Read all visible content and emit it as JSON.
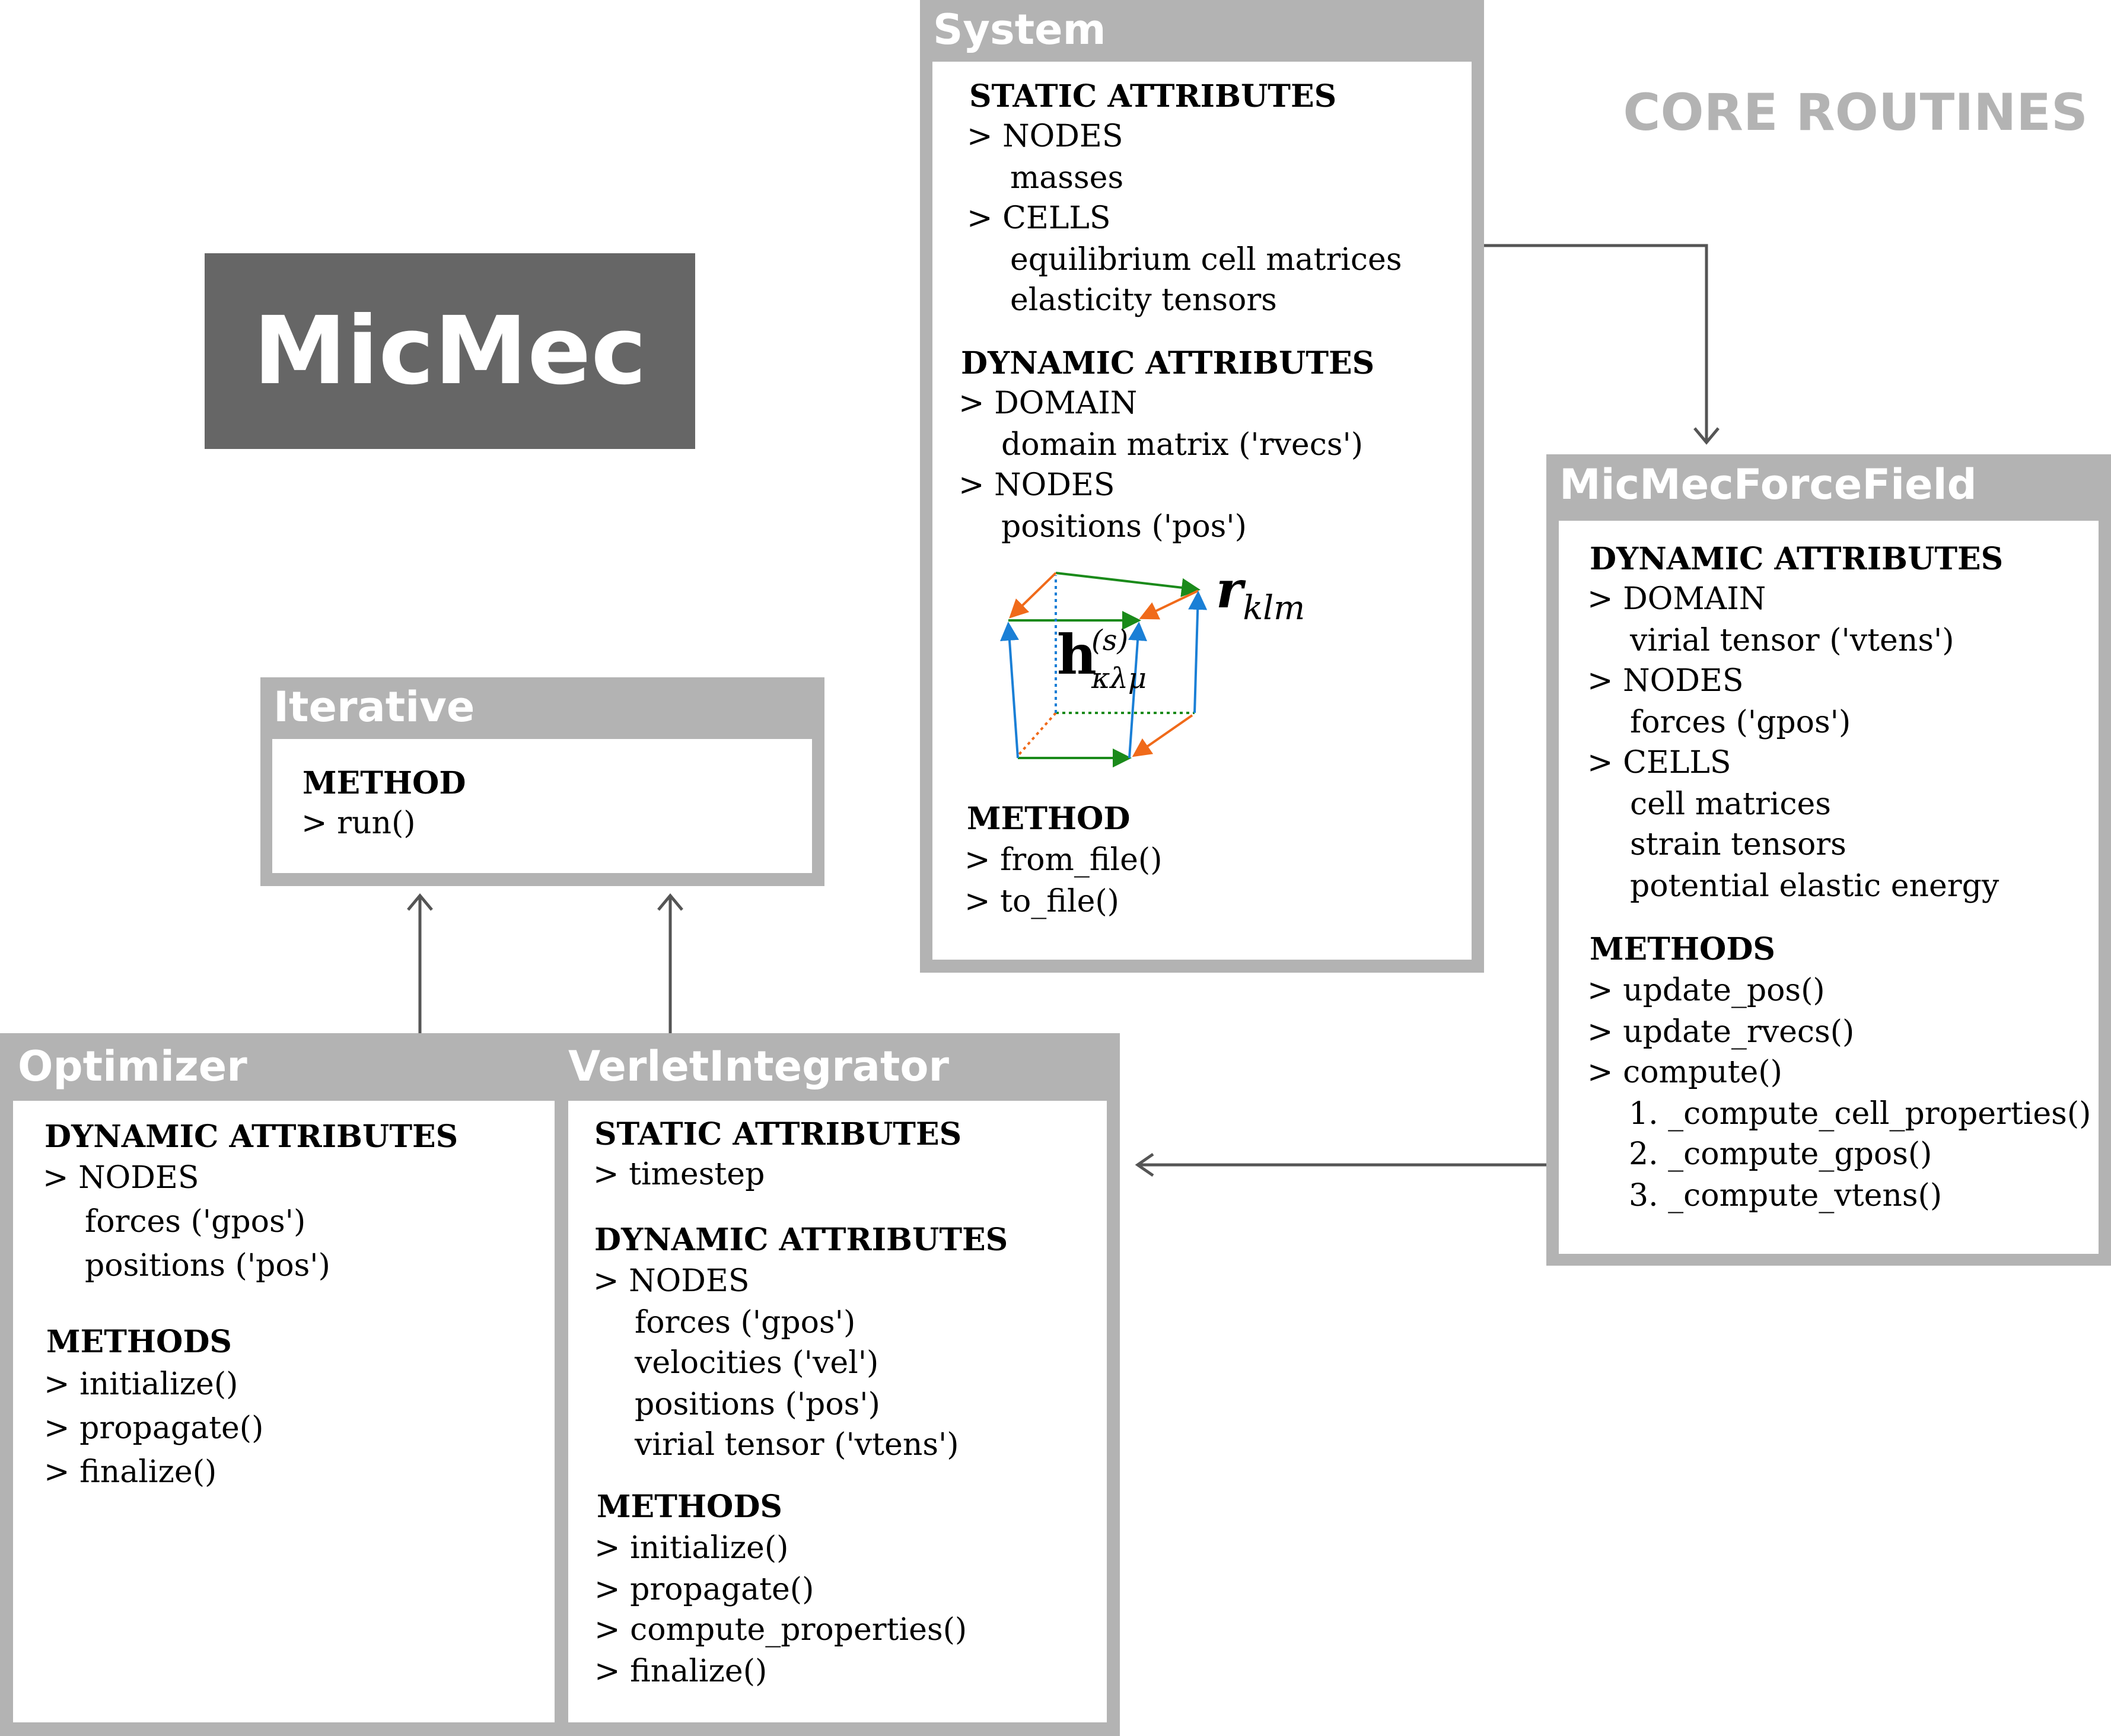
{
  "logo": "MicMec",
  "header": "CORE ROUTINES",
  "colors": {
    "frame": "#b3b3b3",
    "logo_bg": "#666666",
    "arrow": "#555555",
    "cell_green": "#1a8a1a",
    "cell_orange": "#f06a1a",
    "cell_blue": "#1a7fd6"
  },
  "system": {
    "title": "System",
    "static_head": "STATIC ATTRIBUTES",
    "static_lines": [
      "> NODES",
      "masses",
      "> CELLS",
      "equilibrium cell matrices",
      "elasticity tensors"
    ],
    "dynamic_head": "DYNAMIC ATTRIBUTES",
    "dynamic_lines": [
      "> DOMAIN",
      "domain matrix ('rvecs')",
      "> NODES",
      "positions ('pos')"
    ],
    "method_head": "METHOD",
    "method_lines": [
      "> from_file()",
      "> to_file()"
    ],
    "figure": {
      "r_symbol": "r",
      "r_subscript": "klm",
      "h_symbol": "h",
      "h_superscript": "(s)",
      "h_subscript": "κλμ"
    }
  },
  "forcefield": {
    "title": "MicMecForceField",
    "dynamic_head": "DYNAMIC ATTRIBUTES",
    "dynamic_lines": [
      "> DOMAIN",
      "virial tensor ('vtens')",
      "> NODES",
      "forces ('gpos')",
      "> CELLS",
      "cell matrices",
      "strain tensors",
      "potential elastic energy"
    ],
    "methods_head": "METHODS",
    "methods_lines": [
      "> update_pos()",
      "> update_rvecs()",
      "> compute()",
      "1. _compute_cell_properties()",
      "2. _compute_gpos()",
      "3. _compute_vtens()"
    ]
  },
  "iterative": {
    "title": "Iterative",
    "method_head": "METHOD",
    "method_lines": [
      "> run()"
    ]
  },
  "optimizer": {
    "title": "Optimizer",
    "dynamic_head": "DYNAMIC ATTRIBUTES",
    "dynamic_lines": [
      "> NODES",
      "forces ('gpos')",
      "positions ('pos')"
    ],
    "methods_head": "METHODS",
    "methods_lines": [
      "> initialize()",
      "> propagate()",
      "> finalize()"
    ]
  },
  "verlet": {
    "title": "VerletIntegrator",
    "static_head": "STATIC ATTRIBUTES",
    "static_lines": [
      "> timestep"
    ],
    "dynamic_head": "DYNAMIC ATTRIBUTES",
    "dynamic_lines": [
      "> NODES",
      "forces ('gpos')",
      "velocities ('vel')",
      "positions ('pos')",
      "virial tensor ('vtens')"
    ],
    "methods_head": "METHODS",
    "methods_lines": [
      "> initialize()",
      "> propagate()",
      "> compute_properties()",
      "> finalize()"
    ]
  }
}
